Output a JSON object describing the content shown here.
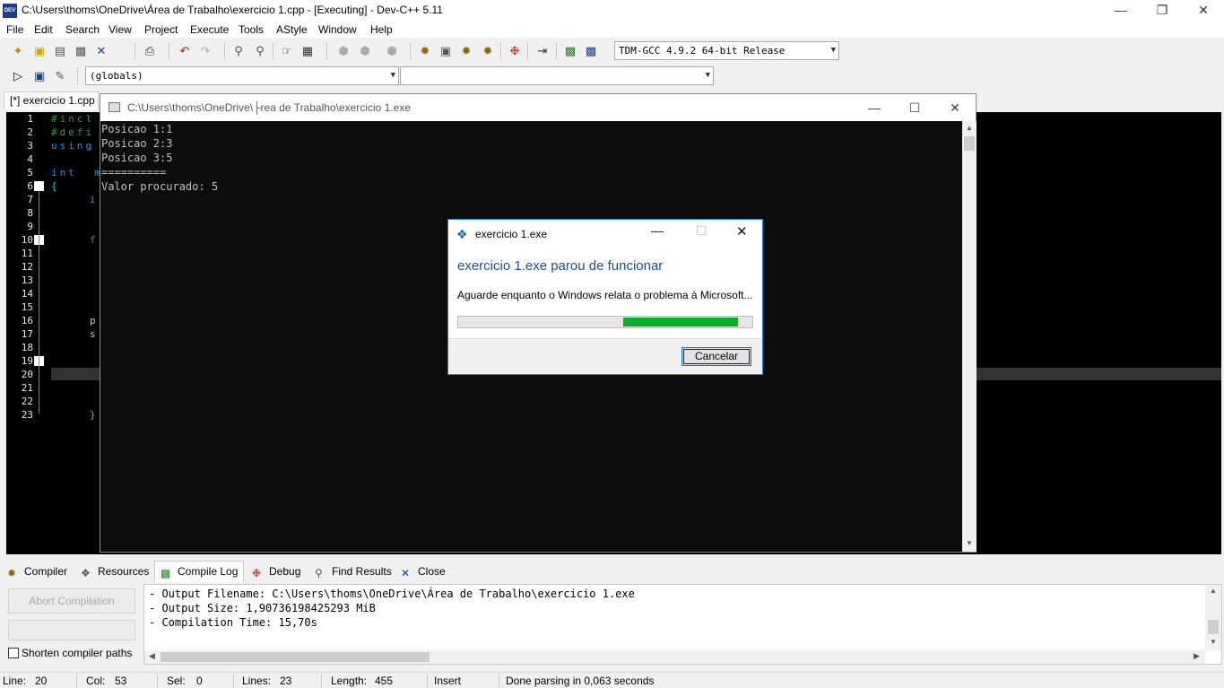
{
  "window": {
    "title": "C:\\Users\\thoms\\OneDrive\\Área de Trabalho\\exercicio 1.cpp - [Executing] - Dev-C++ 5.11",
    "icon_text": "DEV"
  },
  "menu": [
    "File",
    "Edit",
    "Search",
    "View",
    "Project",
    "Execute",
    "Tools",
    "AStyle",
    "Window",
    "Help"
  ],
  "toolbar": {
    "compiler_select": "TDM-GCC 4.9.2 64-bit Release",
    "scope_select": "(globals)",
    "member_select": ""
  },
  "editor": {
    "tab_label": "[*] exercicio 1.cpp",
    "line_numbers": [
      "1",
      "2",
      "3",
      "4",
      "5",
      "6",
      "7",
      "8",
      "9",
      "10",
      "11",
      "12",
      "13",
      "14",
      "15",
      "16",
      "17",
      "18",
      "19",
      "20",
      "21",
      "22",
      "23"
    ],
    "code": {
      "l1": "#incl",
      "l2": "#defi",
      "l3": "using",
      "l5": "int  m",
      "l6": "{",
      "l7": "i",
      "l10": "f",
      "l16": "p",
      "l17": "s",
      "l23": "}"
    }
  },
  "console": {
    "title": "C:\\Users\\thoms\\OneDrive\\├rea de Trabalho\\exercicio 1.exe",
    "lines": [
      "Posicao 1:1",
      "Posicao 2:3",
      "Posicao 3:5",
      "==========",
      "Valor procurado: 5"
    ]
  },
  "dialog": {
    "title": "exercicio 1.exe",
    "heading": "exercicio 1.exe parou de funcionar",
    "message": "Aguarde enquanto o Windows relata o problema à Microsoft...",
    "cancel_label": "Cancelar",
    "progress_color": "#06b025"
  },
  "bottom_tabs": [
    "Compiler",
    "Resources",
    "Compile Log",
    "Debug",
    "Find Results",
    "Close"
  ],
  "compile_panel": {
    "abort_label": "Abort Compilation",
    "shorten_label": "Shorten compiler paths",
    "log": [
      "- Output Filename: C:\\Users\\thoms\\OneDrive\\Área de Trabalho\\exercicio 1.exe",
      "- Output Size: 1,90736198425293 MiB",
      "- Compilation Time: 15,70s"
    ]
  },
  "status": {
    "line_label": "Line:",
    "line_value": "20",
    "col_label": "Col:",
    "col_value": "53",
    "sel_label": "Sel:",
    "sel_value": "0",
    "lines_label": "Lines:",
    "lines_value": "23",
    "length_label": "Length:",
    "length_value": "455",
    "mode": "Insert",
    "message": "Done parsing in 0,063 seconds"
  }
}
